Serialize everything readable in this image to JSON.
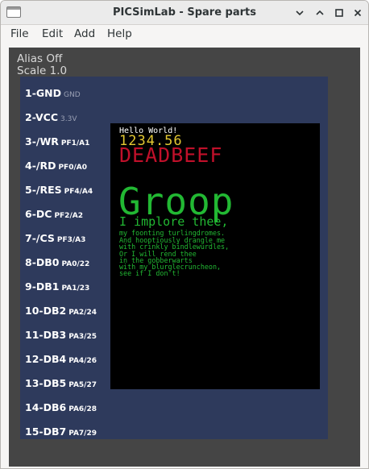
{
  "window": {
    "title": "PICSimLab - Spare parts",
    "minimize_glyph": "∨",
    "close_glyph": "×"
  },
  "menu": [
    "File",
    "Edit",
    "Add",
    "Help"
  ],
  "status": {
    "alias": "Alias Off",
    "scale": "Scale 1.0"
  },
  "pins": [
    {
      "label": "1-GND",
      "sub": "GND",
      "dim": true
    },
    {
      "label": "2-VCC",
      "sub": "3.3V",
      "dim": true
    },
    {
      "label": "3-/WR",
      "sub": "PF1/A1",
      "dim": false
    },
    {
      "label": "4-/RD",
      "sub": "PF0/A0",
      "dim": false
    },
    {
      "label": "5-/RES",
      "sub": "PF4/A4",
      "dim": false
    },
    {
      "label": "6-DC",
      "sub": "PF2/A2",
      "dim": false
    },
    {
      "label": "7-/CS",
      "sub": "PF3/A3",
      "dim": false
    },
    {
      "label": "8-DB0",
      "sub": "PA0/22",
      "dim": false
    },
    {
      "label": "9-DB1",
      "sub": "PA1/23",
      "dim": false
    },
    {
      "label": "10-DB2",
      "sub": "PA2/24",
      "dim": false
    },
    {
      "label": "11-DB3",
      "sub": "PA3/25",
      "dim": false
    },
    {
      "label": "12-DB4",
      "sub": "PA4/26",
      "dim": false
    },
    {
      "label": "13-DB5",
      "sub": "PA5/27",
      "dim": false
    },
    {
      "label": "14-DB6",
      "sub": "PA6/28",
      "dim": false
    },
    {
      "label": "15-DB7",
      "sub": "PA7/29",
      "dim": false
    }
  ],
  "lcd": {
    "hello": "Hello World!",
    "number": "1234.56",
    "hex": "DEADBEEF",
    "big": "Groop",
    "sub": "I implore thee,",
    "lines": [
      "my foonting turlingdromes.",
      "And hooptiously drangle me",
      "with crinkly bindlewurdles,",
      "Or I will rend thee",
      "in the gobberwarts",
      "with my blurglecruncheon,",
      "see if I don't!"
    ]
  },
  "colors": {
    "board": "#2e3a5c",
    "workspace": "#454545",
    "lcd_yellow": "#e3c832",
    "lcd_red": "#c0102a",
    "lcd_green": "#22b833"
  }
}
